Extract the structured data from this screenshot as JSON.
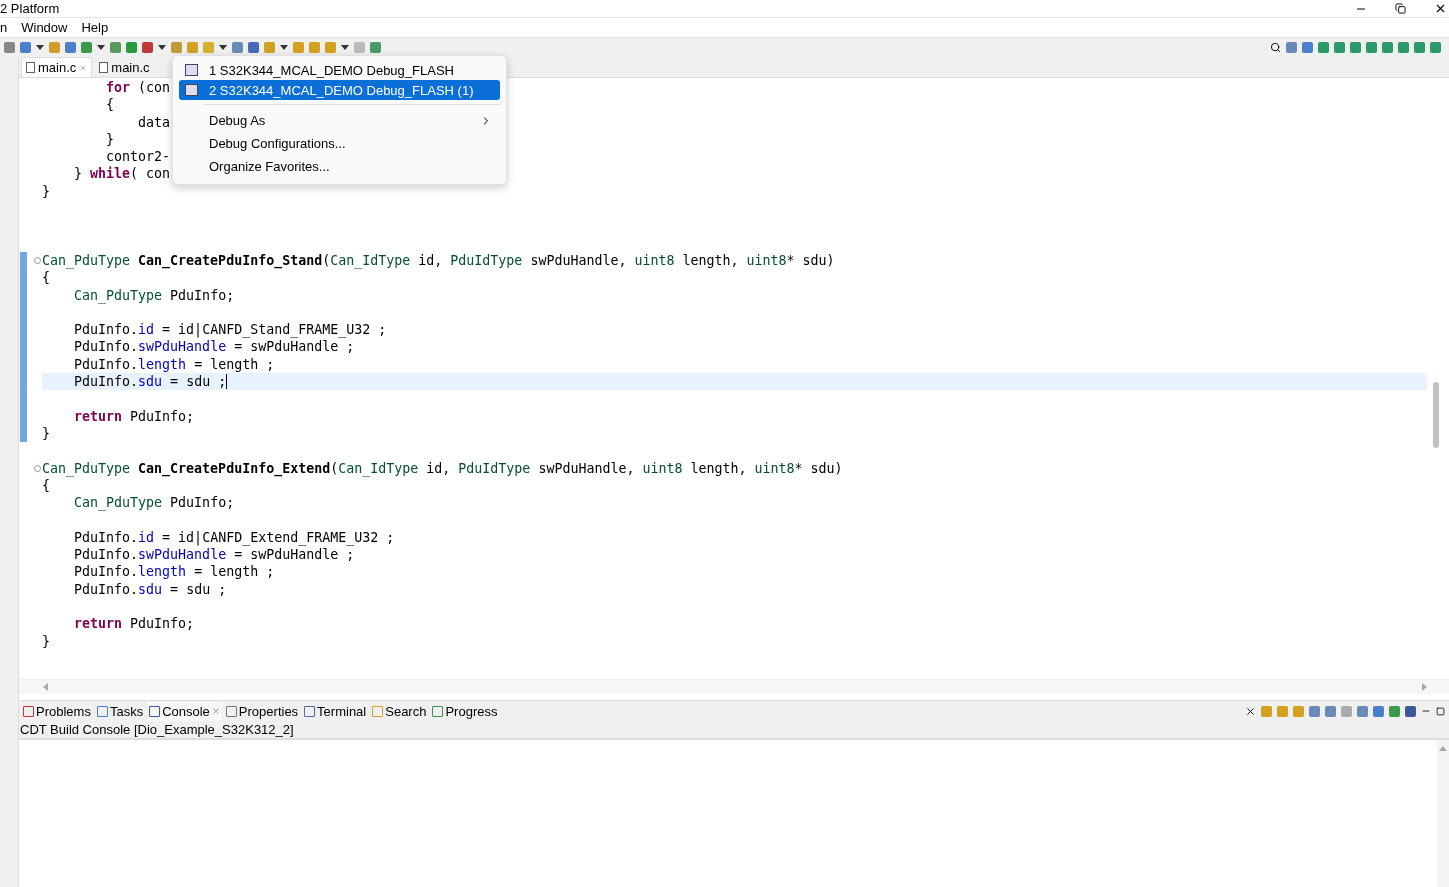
{
  "window": {
    "title": "2 Platform"
  },
  "menu_bar": [
    "n",
    "Window",
    "Help"
  ],
  "editor_tabs": [
    {
      "label": "main.c",
      "selected": true
    },
    {
      "label": "main.c",
      "selected": false
    }
  ],
  "code": [
    {
      "kind": "code",
      "tokens": [
        {
          "t": "        for",
          "kind": "keyword"
        },
        {
          "t": " (con",
          "kind": "plain"
        }
      ]
    },
    {
      "kind": "code",
      "tokens": [
        {
          "t": "        {",
          "kind": "plain"
        }
      ]
    },
    {
      "kind": "code",
      "tokens": [
        {
          "t": "            data",
          "kind": "plain"
        }
      ]
    },
    {
      "kind": "code",
      "tokens": [
        {
          "t": "        }",
          "kind": "plain"
        }
      ]
    },
    {
      "kind": "code",
      "tokens": [
        {
          "t": "        contor2-",
          "kind": "plain"
        }
      ]
    },
    {
      "kind": "code",
      "tokens": [
        {
          "t": "    } ",
          "kind": "plain"
        },
        {
          "t": "while",
          "kind": "keyword"
        },
        {
          "t": "( con",
          "kind": "plain"
        }
      ]
    },
    {
      "kind": "code",
      "tokens": [
        {
          "t": "}",
          "kind": "plain"
        }
      ]
    },
    {
      "kind": "blank"
    },
    {
      "kind": "blank"
    },
    {
      "kind": "blank"
    },
    {
      "kind": "code",
      "fold": true,
      "changed": true,
      "tokens": [
        {
          "t": "Can_PduType",
          "kind": "type"
        },
        {
          "t": " Can_CreatePduInfo_Stand",
          "kind": "bold"
        },
        {
          "t": "(",
          "kind": "plain"
        },
        {
          "t": "Can_IdType",
          "kind": "type"
        },
        {
          "t": " id, ",
          "kind": "plain"
        },
        {
          "t": "PduIdType",
          "kind": "type"
        },
        {
          "t": " swPduHandle, ",
          "kind": "plain"
        },
        {
          "t": "uint8",
          "kind": "type"
        },
        {
          "t": " length, ",
          "kind": "plain"
        },
        {
          "t": "uint8",
          "kind": "type"
        },
        {
          "t": "* sdu)",
          "kind": "plain"
        }
      ]
    },
    {
      "kind": "code",
      "changed": true,
      "tokens": [
        {
          "t": "{",
          "kind": "plain"
        }
      ]
    },
    {
      "kind": "code",
      "changed": true,
      "tokens": [
        {
          "t": "    Can_PduType",
          "kind": "type"
        },
        {
          "t": " PduInfo;",
          "kind": "plain"
        }
      ]
    },
    {
      "kind": "blank",
      "changed": true
    },
    {
      "kind": "code",
      "changed": true,
      "tokens": [
        {
          "t": "    PduInfo.",
          "kind": "plain"
        },
        {
          "t": "id",
          "kind": "field"
        },
        {
          "t": " = id|CANFD_Stand_FRAME_U32 ;",
          "kind": "plain"
        }
      ]
    },
    {
      "kind": "code",
      "changed": true,
      "tokens": [
        {
          "t": "    PduInfo.",
          "kind": "plain"
        },
        {
          "t": "swPduHandle",
          "kind": "field"
        },
        {
          "t": " = swPduHandle ;",
          "kind": "plain"
        }
      ]
    },
    {
      "kind": "code",
      "changed": true,
      "tokens": [
        {
          "t": "    PduInfo.",
          "kind": "plain"
        },
        {
          "t": "length",
          "kind": "field"
        },
        {
          "t": " = length ;",
          "kind": "plain"
        }
      ]
    },
    {
      "kind": "code",
      "changed": true,
      "current": true,
      "tokens": [
        {
          "t": "    PduInfo.",
          "kind": "plain"
        },
        {
          "t": "sdu",
          "kind": "field"
        },
        {
          "t": " = sdu ;",
          "kind": "plain"
        }
      ]
    },
    {
      "kind": "blank",
      "changed": true
    },
    {
      "kind": "code",
      "changed": true,
      "tokens": [
        {
          "t": "    return",
          "kind": "keyword"
        },
        {
          "t": " PduInfo;",
          "kind": "plain"
        }
      ]
    },
    {
      "kind": "code",
      "changed": true,
      "tokens": [
        {
          "t": "}",
          "kind": "plain"
        }
      ]
    },
    {
      "kind": "blank"
    },
    {
      "kind": "code",
      "fold": true,
      "tokens": [
        {
          "t": "Can_PduType",
          "kind": "type"
        },
        {
          "t": " Can_CreatePduInfo_Extend",
          "kind": "bold"
        },
        {
          "t": "(",
          "kind": "plain"
        },
        {
          "t": "Can_IdType",
          "kind": "type"
        },
        {
          "t": " id, ",
          "kind": "plain"
        },
        {
          "t": "PduIdType",
          "kind": "type"
        },
        {
          "t": " swPduHandle, ",
          "kind": "plain"
        },
        {
          "t": "uint8",
          "kind": "type"
        },
        {
          "t": " length, ",
          "kind": "plain"
        },
        {
          "t": "uint8",
          "kind": "type"
        },
        {
          "t": "* sdu)",
          "kind": "plain"
        }
      ]
    },
    {
      "kind": "code",
      "tokens": [
        {
          "t": "{",
          "kind": "plain"
        }
      ]
    },
    {
      "kind": "code",
      "tokens": [
        {
          "t": "    Can_PduType",
          "kind": "type"
        },
        {
          "t": " PduInfo;",
          "kind": "plain"
        }
      ]
    },
    {
      "kind": "blank"
    },
    {
      "kind": "code",
      "tokens": [
        {
          "t": "    PduInfo.",
          "kind": "plain"
        },
        {
          "t": "id",
          "kind": "field"
        },
        {
          "t": " = id|CANFD_Extend_FRAME_U32 ;",
          "kind": "plain"
        }
      ]
    },
    {
      "kind": "code",
      "tokens": [
        {
          "t": "    PduInfo.",
          "kind": "plain"
        },
        {
          "t": "swPduHandle",
          "kind": "field"
        },
        {
          "t": " = swPduHandle ;",
          "kind": "plain"
        }
      ]
    },
    {
      "kind": "code",
      "tokens": [
        {
          "t": "    PduInfo.",
          "kind": "plain"
        },
        {
          "t": "length",
          "kind": "field"
        },
        {
          "t": " = length ;",
          "kind": "plain"
        }
      ]
    },
    {
      "kind": "code",
      "tokens": [
        {
          "t": "    PduInfo.",
          "kind": "plain"
        },
        {
          "t": "sdu",
          "kind": "field"
        },
        {
          "t": " = sdu ;",
          "kind": "plain"
        }
      ]
    },
    {
      "kind": "blank"
    },
    {
      "kind": "code",
      "tokens": [
        {
          "t": "    return",
          "kind": "keyword"
        },
        {
          "t": " PduInfo;",
          "kind": "plain"
        }
      ]
    },
    {
      "kind": "code",
      "tokens": [
        {
          "t": "}",
          "kind": "plain"
        }
      ]
    }
  ],
  "dropdown_menu": [
    {
      "kind": "config",
      "label": "1 S32K344_MCAL_DEMO Debug_FLASH",
      "selected": false
    },
    {
      "kind": "config",
      "label": "2 S32K344_MCAL_DEMO Debug_FLASH (1)",
      "selected": true
    },
    {
      "kind": "separator"
    },
    {
      "kind": "submenu",
      "label": "Debug As"
    },
    {
      "kind": "action",
      "label": "Debug Configurations..."
    },
    {
      "kind": "action",
      "label": "Organize Favorites..."
    }
  ],
  "bottom_tabs": [
    {
      "label": "Problems",
      "selected": false
    },
    {
      "label": "Tasks",
      "selected": false
    },
    {
      "label": "Console",
      "selected": true
    },
    {
      "label": "Properties",
      "selected": false
    },
    {
      "label": "Terminal",
      "selected": false
    },
    {
      "label": "Search",
      "selected": false
    },
    {
      "label": "Progress",
      "selected": false
    }
  ],
  "console": {
    "title": "CDT Build Console [Dio_Example_S32K312_2]"
  }
}
